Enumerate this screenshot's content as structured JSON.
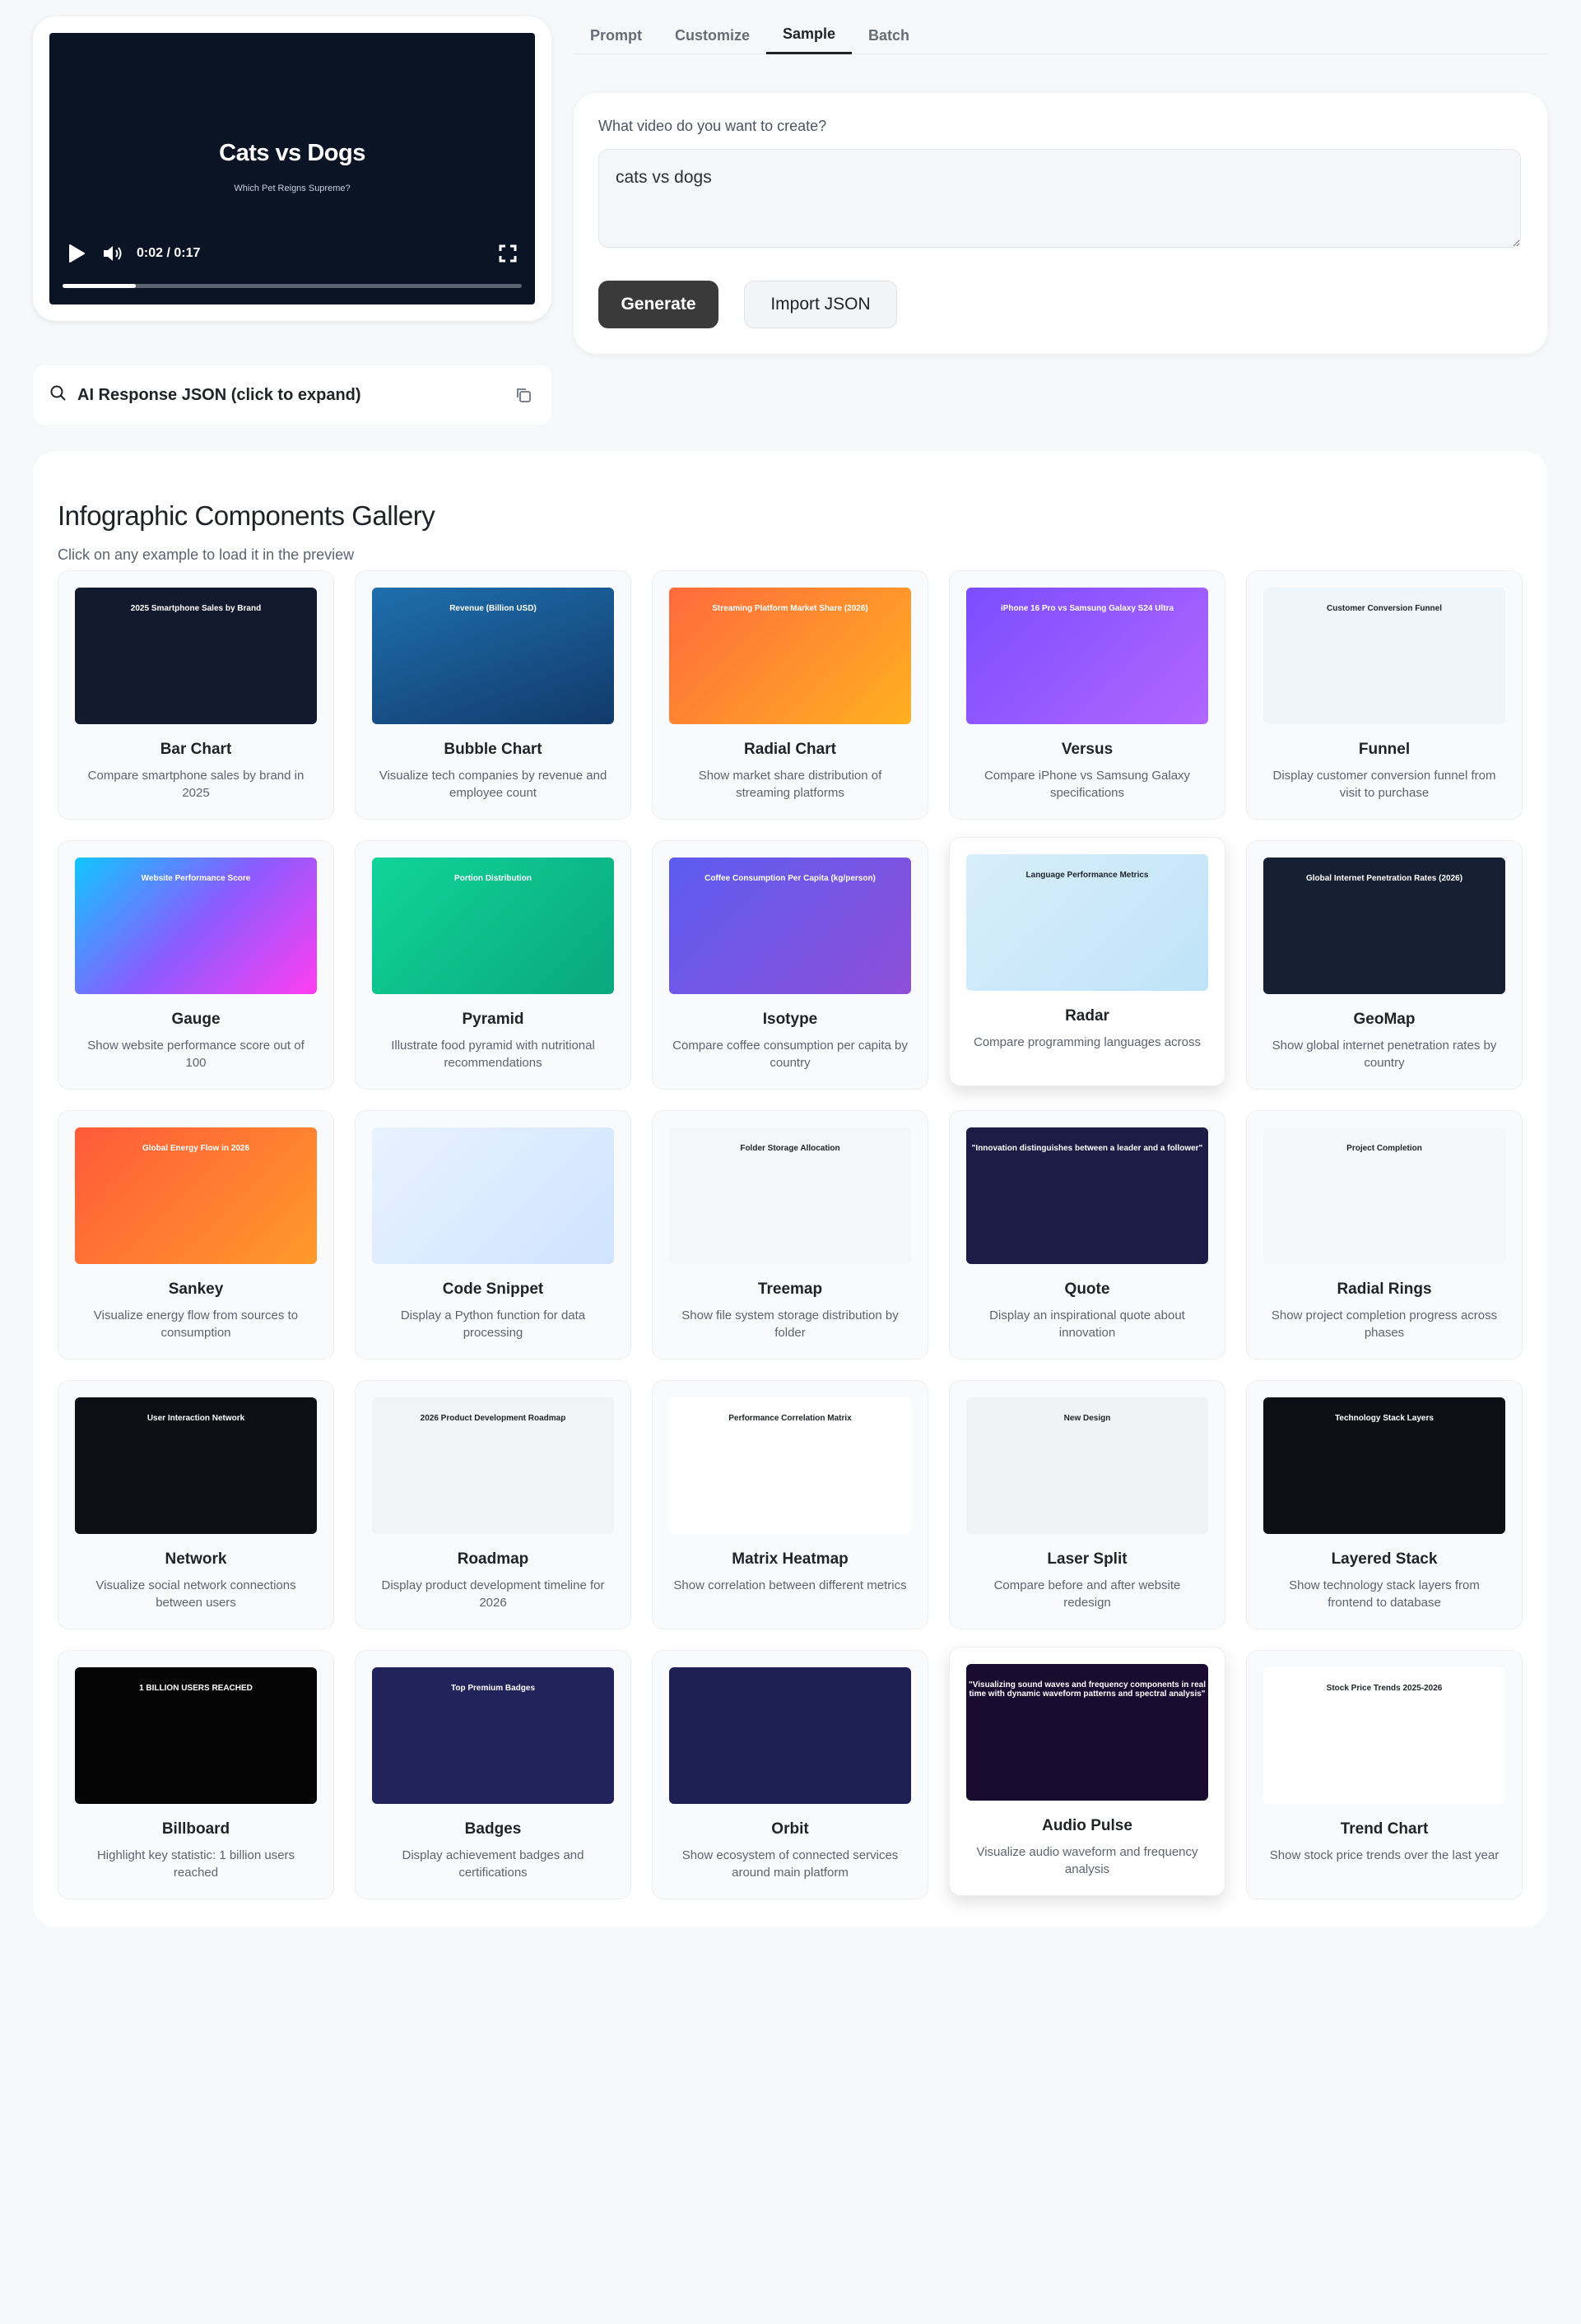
{
  "video": {
    "title": "Cats vs Dogs",
    "subtitle": "Which Pet Reigns Supreme?",
    "time": "0:02 / 0:17",
    "progress": 0.16
  },
  "json_panel": {
    "label": "AI Response JSON (click to expand)"
  },
  "tabs": [
    {
      "label": "Prompt"
    },
    {
      "label": "Customize"
    },
    {
      "label": "Sample"
    },
    {
      "label": "Batch"
    }
  ],
  "prompt": {
    "label": "What video do you want to create?",
    "value": "cats vs dogs",
    "generate": "Generate",
    "import": "Import JSON"
  },
  "gallery": {
    "title": "Infographic Components Gallery",
    "subtitle": "Click on any example to load it in the preview",
    "items": [
      {
        "title": "Bar Chart",
        "desc": "Compare smartphone sales by brand in 2025",
        "caption": "2025 Smartphone Sales by Brand"
      },
      {
        "title": "Bubble Chart",
        "desc": "Visualize tech companies by revenue and employee count",
        "caption": "Revenue (Billion USD)"
      },
      {
        "title": "Radial Chart",
        "desc": "Show market share distribution of streaming platforms",
        "caption": "Streaming Platform Market Share (2026)"
      },
      {
        "title": "Versus",
        "desc": "Compare iPhone vs Samsung Galaxy specifications",
        "caption": "iPhone 16 Pro vs Samsung Galaxy S24 Ultra"
      },
      {
        "title": "Funnel",
        "desc": "Display customer conversion funnel from visit to purchase",
        "caption": "Customer Conversion Funnel"
      },
      {
        "title": "Gauge",
        "desc": "Show website performance score out of 100",
        "caption": "Website Performance Score"
      },
      {
        "title": "Pyramid",
        "desc": "Illustrate food pyramid with nutritional recommendations",
        "caption": "Portion Distribution"
      },
      {
        "title": "Isotype",
        "desc": "Compare coffee consumption per capita by country",
        "caption": "Coffee Consumption Per Capita (kg/person)"
      },
      {
        "title": "Radar",
        "desc": "Compare programming languages across multiple criteria",
        "caption": "Language Performance Metrics"
      },
      {
        "title": "GeoMap",
        "desc": "Show global internet penetration rates by country",
        "caption": "Global Internet Penetration Rates (2026)"
      },
      {
        "title": "Sankey",
        "desc": "Visualize energy flow from sources to consumption",
        "caption": "Global Energy Flow in 2026"
      },
      {
        "title": "Code Snippet",
        "desc": "Display a Python function for data processing",
        "caption": ""
      },
      {
        "title": "Treemap",
        "desc": "Show file system storage distribution by folder",
        "caption": "Folder Storage Allocation"
      },
      {
        "title": "Quote",
        "desc": "Display an inspirational quote about innovation",
        "caption": "\"Innovation distinguishes between a leader and a follower\""
      },
      {
        "title": "Radial Rings",
        "desc": "Show project completion progress across phases",
        "caption": "Project Completion"
      },
      {
        "title": "Network",
        "desc": "Visualize social network connections between users",
        "caption": "User Interaction Network"
      },
      {
        "title": "Roadmap",
        "desc": "Display product development timeline for 2026",
        "caption": "2026 Product Development Roadmap"
      },
      {
        "title": "Matrix Heatmap",
        "desc": "Show correlation between different metrics",
        "caption": "Performance Correlation Matrix"
      },
      {
        "title": "Laser Split",
        "desc": "Compare before and after website redesign",
        "caption": "New Design"
      },
      {
        "title": "Layered Stack",
        "desc": "Show technology stack layers from frontend to database",
        "caption": "Technology Stack Layers"
      },
      {
        "title": "Billboard",
        "desc": "Highlight key statistic: 1 billion users reached",
        "caption": "1 BILLION USERS REACHED"
      },
      {
        "title": "Badges",
        "desc": "Display achievement badges and certifications",
        "caption": "Top Premium Badges"
      },
      {
        "title": "Orbit",
        "desc": "Show ecosystem of connected services around main platform",
        "caption": ""
      },
      {
        "title": "Audio Pulse",
        "desc": "Visualize audio waveform and frequency analysis",
        "caption": "\"Visualizing sound waves and frequency components in real time with dynamic waveform patterns and spectral analysis\""
      },
      {
        "title": "Trend Chart",
        "desc": "Show stock price trends over the last year",
        "caption": "Stock Price Trends 2025-2026"
      }
    ]
  },
  "colors": {
    "accent_dark": "#3a3a3a",
    "thumb_backgrounds": [
      "#141a2e",
      "#1d5a8c",
      "#ff8a3d",
      "#8a4dff",
      "#eef6fb",
      "#2fb3f3",
      "#19c28e",
      "#6a4fe0",
      "#cfe9f8",
      "#162033",
      "#ff7a35",
      "#dcecff",
      "#f4f6f8",
      "#1c1c47",
      "#f6f7f9",
      "#0e0f15",
      "#f1f3f6",
      "#ffffff",
      "#f1f2f5",
      "#0d1014",
      "#050505",
      "#23235c",
      "#1e2054",
      "#1a0c30",
      "#ffffff"
    ]
  }
}
